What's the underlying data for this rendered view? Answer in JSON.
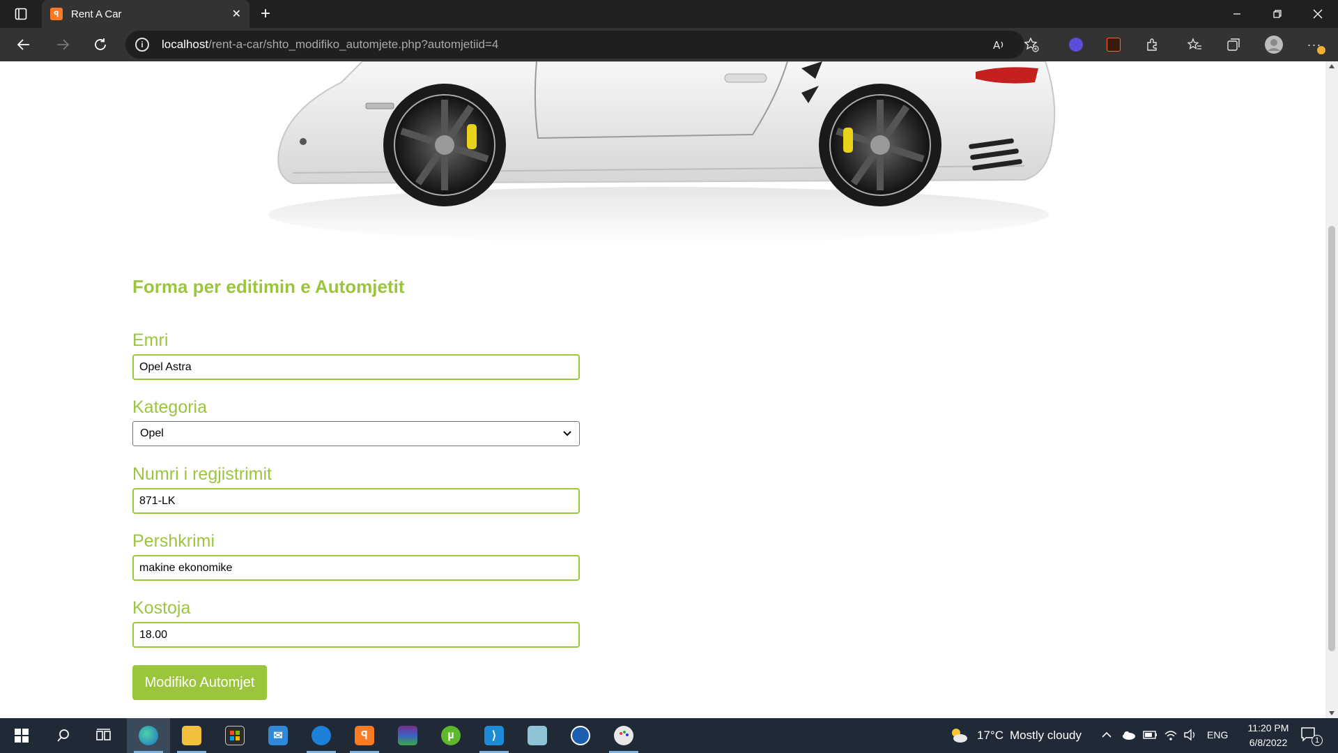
{
  "browser": {
    "tab_title": "Rent A Car",
    "tab_close": "✕",
    "new_tab": "+",
    "url_host": "localhost",
    "url_path": "/rent-a-car/shto_modifiko_automjete.php?automjetiid=4"
  },
  "form": {
    "title": "Forma per editimin e Automjetit",
    "fields": [
      {
        "label": "Emri",
        "value": "Opel Astra"
      },
      {
        "label": "Kategoria",
        "value": "Opel"
      },
      {
        "label": "Numri i regjistrimit",
        "value": "871-LK"
      },
      {
        "label": "Pershkrimi",
        "value": "makine ekonomike"
      },
      {
        "label": "Kostoja",
        "value": "18.00"
      }
    ],
    "submit_label": "Modifiko Automjet"
  },
  "taskbar": {
    "weather_temp": "17°C",
    "weather_text": "Mostly cloudy",
    "language": "ENG",
    "time": "11:20 PM",
    "date": "6/8/2022",
    "notification_count": "1"
  },
  "colors": {
    "accent_green": "#9bc53d",
    "chrome_dark": "#202020",
    "taskbar": "#1f2a36"
  }
}
